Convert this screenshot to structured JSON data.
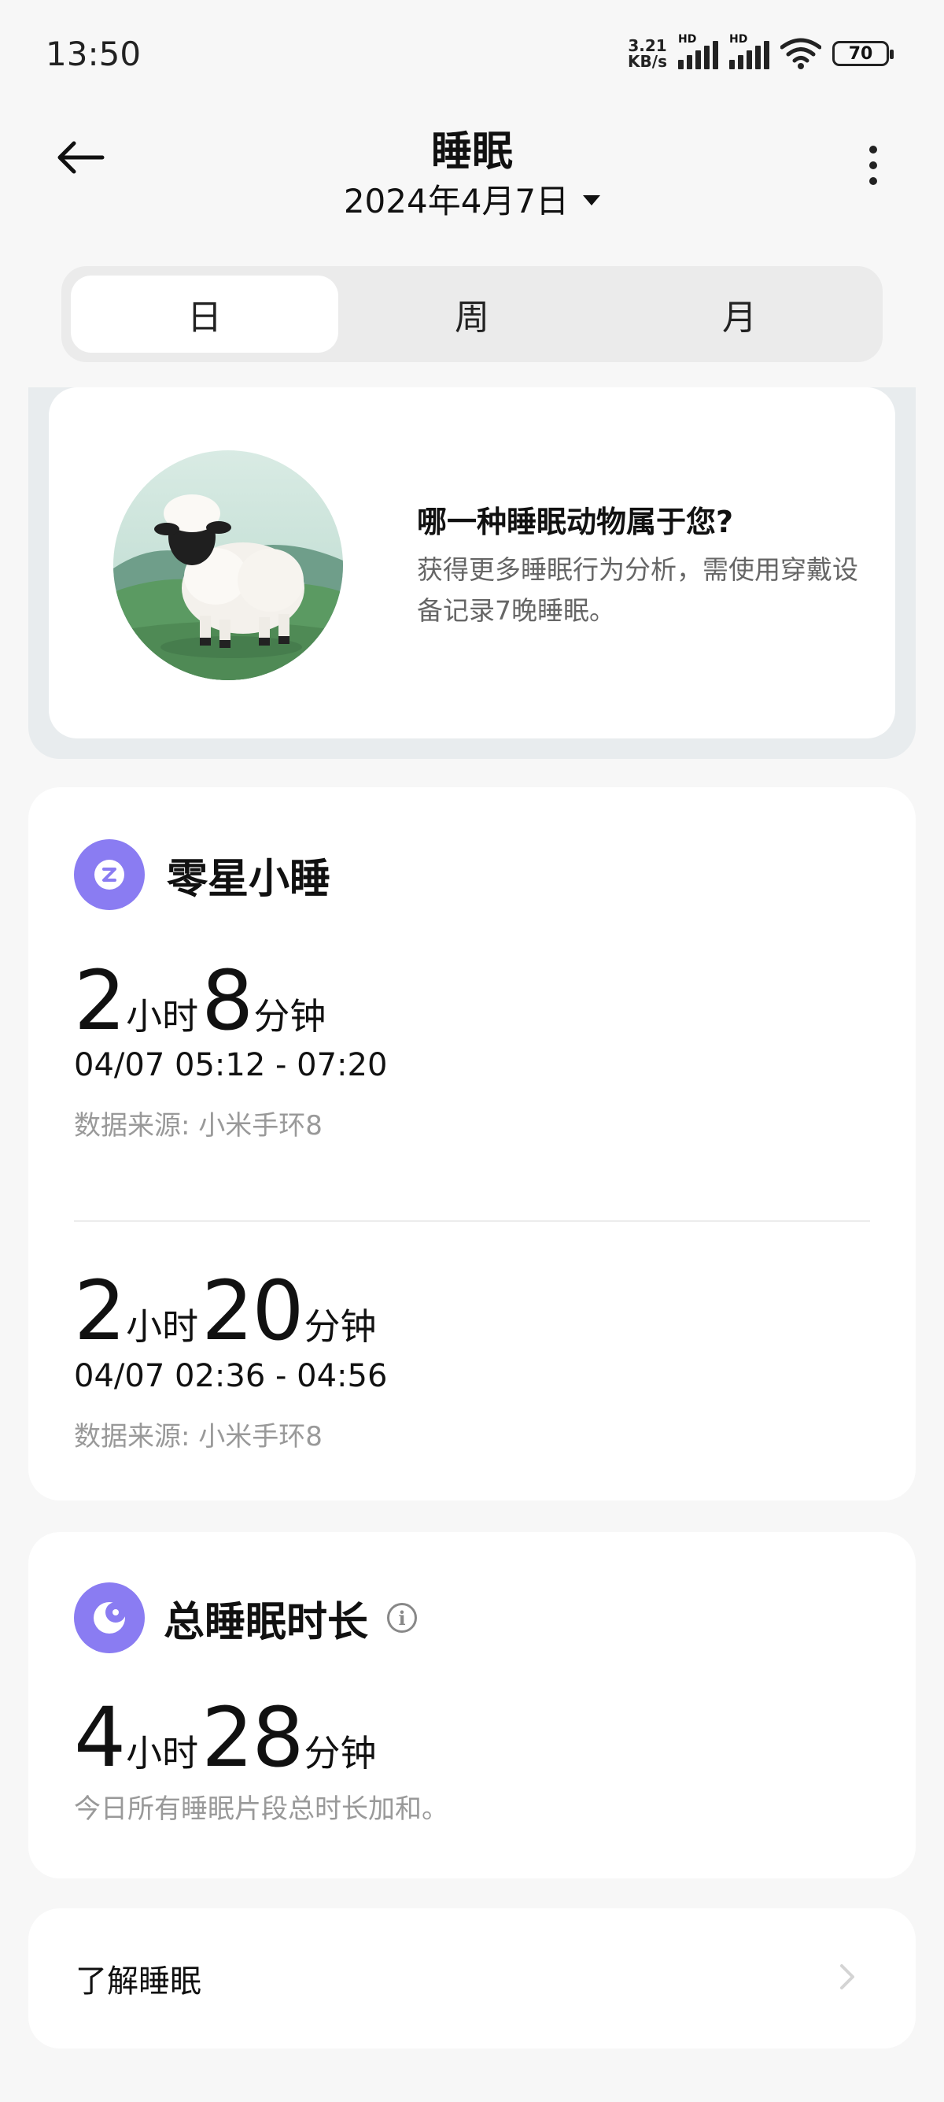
{
  "status_bar": {
    "time": "13:50",
    "net_speed_value": "3.21",
    "net_speed_unit": "KB/s",
    "hd_label": "HD",
    "battery": "70"
  },
  "header": {
    "title": "睡眠",
    "date": "2024年4月7日"
  },
  "tabs": [
    {
      "label": "日",
      "active": true
    },
    {
      "label": "周",
      "active": false
    },
    {
      "label": "月",
      "active": false
    }
  ],
  "promo": {
    "title": "哪一种睡眠动物属于您?",
    "description": "获得更多睡眠行为分析，需使用穿戴设备记录7晚睡眠。"
  },
  "nap": {
    "title": "零星小睡",
    "icon": "nap-z-icon",
    "sessions": [
      {
        "hours": "2",
        "hour_unit": "小时",
        "minutes": "8",
        "minute_unit": "分钟",
        "range": "04/07 05:12 - 07:20",
        "source": "数据来源: 小米手环8"
      },
      {
        "hours": "2",
        "hour_unit": "小时",
        "minutes": "20",
        "minute_unit": "分钟",
        "range": "04/07 02:36 - 04:56",
        "source": "数据来源: 小米手环8"
      }
    ]
  },
  "total": {
    "title": "总睡眠时长",
    "icon": "moon-icon",
    "hours": "4",
    "hour_unit": "小时",
    "minutes": "28",
    "minute_unit": "分钟",
    "note": "今日所有睡眠片段总时长加和。"
  },
  "learn": {
    "label": "了解睡眠"
  },
  "colors": {
    "accent": "#8a7cf2",
    "background": "#f7f7f7",
    "card": "#ffffff",
    "muted_text": "#999999"
  }
}
